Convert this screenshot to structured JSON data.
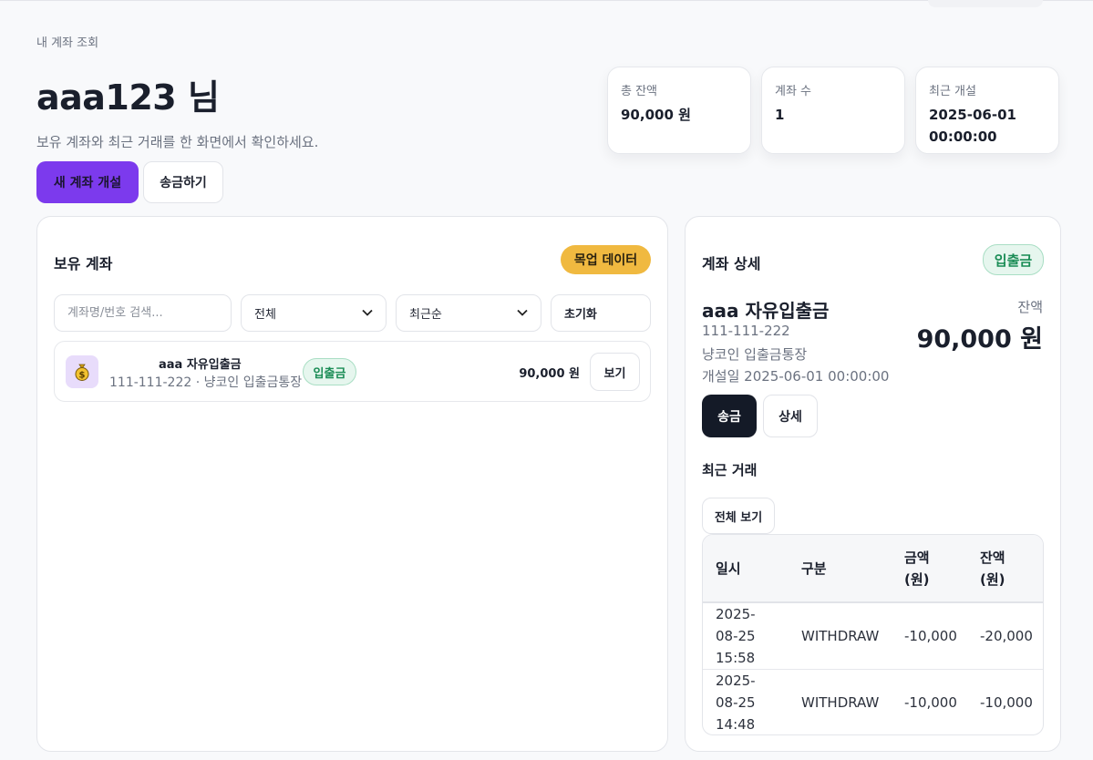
{
  "header": {
    "caption": "내 계좌 조회",
    "title": "aaa123 님",
    "subtitle": "보유 계좌와 최근 거래를 한 화면에서 확인하세요.",
    "new_account_label": "새 계좌 개설",
    "transfer_label": "송금하기"
  },
  "stats": [
    {
      "label": "총 잔액",
      "value": "90,000 원"
    },
    {
      "label": "계좌 수",
      "value": "1"
    },
    {
      "label": "최근 개설",
      "value": "2025-06-01 00:00:00"
    }
  ],
  "accounts_panel": {
    "title": "보유 계좌",
    "badge": "목업 데이터",
    "search_placeholder": "계좌명/번호 검색...",
    "type_filter": "전체",
    "sort_filter": "최근순",
    "reset_label": "초기화",
    "accounts": [
      {
        "name": "aaa 자유입출금",
        "sub": "111-111-222 · 냥코인 입출금통장",
        "type": "입출금",
        "balance": "90,000 원",
        "view_label": "보기"
      }
    ]
  },
  "detail_panel": {
    "title": "계좌 상세",
    "type": "입출금",
    "name": "aaa 자유입출금",
    "number": "111-111-222",
    "product": "냥코인 입출금통장",
    "opened": "개설일 2025-06-01 00:00:00",
    "balance_label": "잔액",
    "balance": "90,000 원",
    "transfer_label": "송금",
    "detail_label": "상세",
    "recent_title": "최근 거래",
    "view_all_label": "전체 보기",
    "columns": [
      "일시",
      "구분",
      "금액 (원)",
      "잔액 (원)"
    ],
    "transactions": [
      {
        "datetime": "2025-08-25 15:58",
        "kind": "WITHDRAW",
        "amount": "-10,000",
        "balance": "-20,000"
      },
      {
        "datetime": "2025-08-25 14:48",
        "kind": "WITHDRAW",
        "amount": "-10,000",
        "balance": "-10,000"
      }
    ]
  },
  "colors": {
    "accent": "#7c3aed",
    "badge_yellow": "#f0b940",
    "pill_green": "#1a8c55",
    "dark_button": "#141a27"
  },
  "icons": {
    "account_avatar": "money-bag-icon"
  }
}
